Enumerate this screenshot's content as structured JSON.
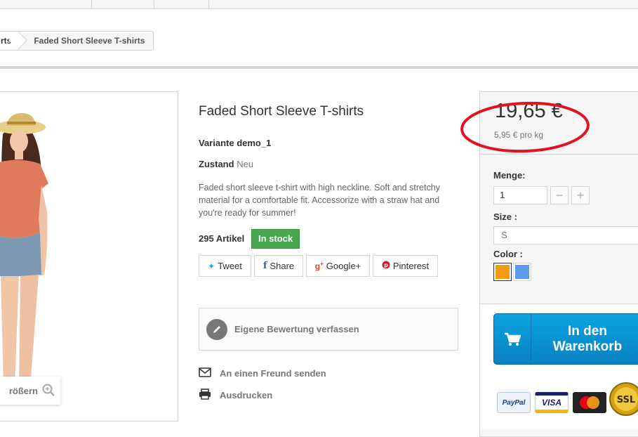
{
  "breadcrumb": {
    "parent": "rts",
    "current": "Faded Short Sleeve T-shirts"
  },
  "product": {
    "title": "Faded Short Sleeve T-shirts",
    "variant": "Variante demo_1",
    "condition_label": "Zustand",
    "condition_value": "Neu",
    "description": "Faded short sleeve t-shirt with high neckline. Soft and stretchy material for a comfortable fit. Accessorize with a straw hat and you're ready for summer!",
    "quantity_text": "295 Artikel",
    "stock_badge": "In stock"
  },
  "image": {
    "zoom_label": "rößern"
  },
  "social": {
    "tweet": "Tweet",
    "share": "Share",
    "google": "Google+",
    "pinterest": "Pinterest"
  },
  "review": {
    "label": "Eigene Bewertung verfassen"
  },
  "links": {
    "send_friend": "An einen Freund senden",
    "print": "Ausdrucken"
  },
  "buybox": {
    "price": "19,65 €",
    "unit_price": "5,95 € pro kg",
    "quantity_label": "Menge:",
    "quantity_value": "1",
    "minus": "−",
    "plus": "+",
    "size_label": "Size :",
    "size_value": "S",
    "color_label": "Color :",
    "cart_line1": "In den",
    "cart_line2": "Warenkorb"
  },
  "colors": {
    "swatch_orange": "#f39c11",
    "swatch_blue": "#5d9cec",
    "stock_green": "#46a74e",
    "cart_blue": "#0a98d8",
    "annotation_red": "#e0141e"
  },
  "payments": [
    "PayPal",
    "VISA",
    "MasterCard",
    "SSL"
  ]
}
